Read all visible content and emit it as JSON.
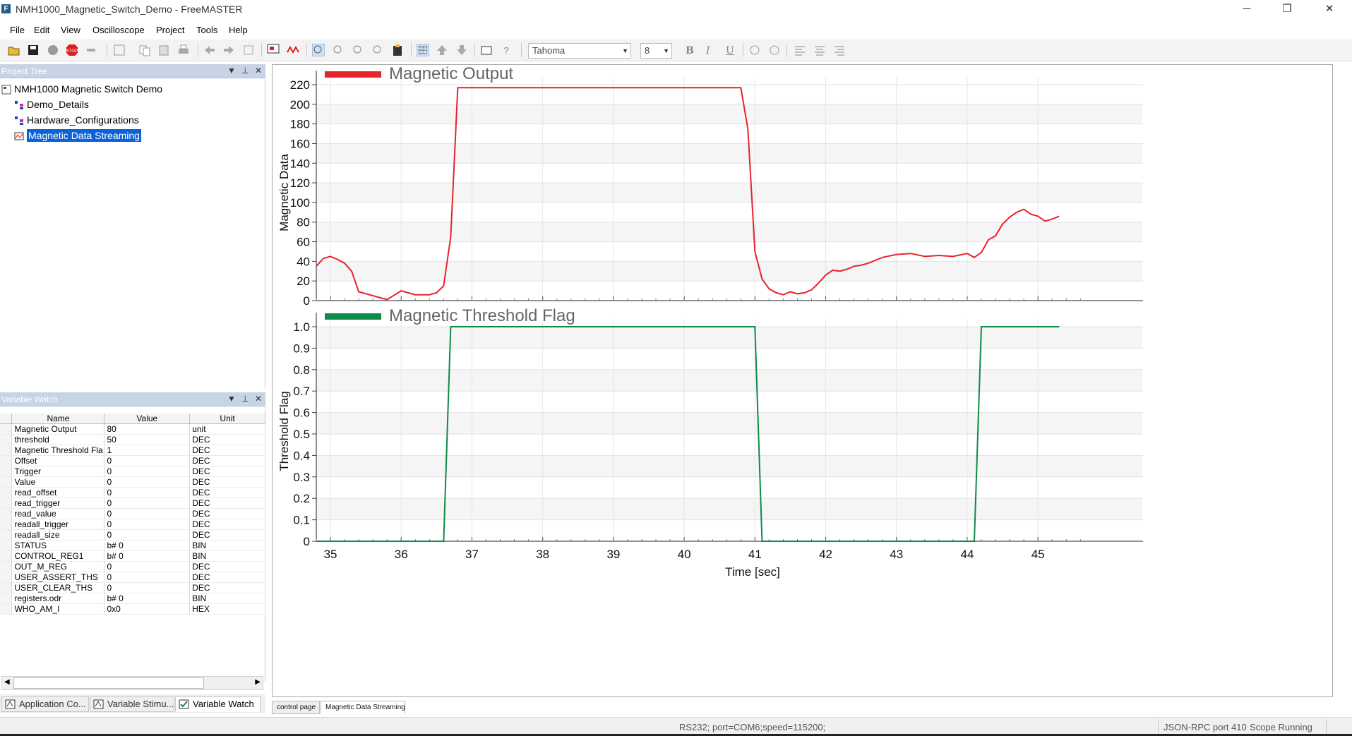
{
  "window": {
    "title": "NMH1000_Magnetic_Switch_Demo - FreeMASTER",
    "app_icon_letter": "F",
    "minimize": "─",
    "restore": "❐",
    "close": "✕"
  },
  "menu": [
    "File",
    "Edit",
    "View",
    "Oscilloscope",
    "Project",
    "Tools",
    "Help"
  ],
  "toolbar": {
    "font_name": "Tahoma",
    "font_size": "8",
    "bold": "B",
    "italic": "I",
    "underline": "U"
  },
  "project_tree": {
    "title": "Project Tree",
    "root": "NMH1000 Magnetic Switch Demo",
    "items": [
      "Demo_Details",
      "Hardware_Configurations",
      "Magnetic Data Streaming"
    ],
    "selected_index": 2
  },
  "variable_watch": {
    "title": "Variable Watch",
    "columns": [
      "Name",
      "Value",
      "Unit"
    ],
    "rows": [
      [
        "Magnetic Output",
        "80",
        "unit"
      ],
      [
        "threshold",
        "50",
        "DEC"
      ],
      [
        "Magnetic Threshold Fla",
        "1",
        "DEC"
      ],
      [
        "Offset",
        "0",
        "DEC"
      ],
      [
        "Trigger",
        "0",
        "DEC"
      ],
      [
        "Value",
        "0",
        "DEC"
      ],
      [
        "read_offset",
        "0",
        "DEC"
      ],
      [
        "read_trigger",
        "0",
        "DEC"
      ],
      [
        "read_value",
        "0",
        "DEC"
      ],
      [
        "readall_trigger",
        "0",
        "DEC"
      ],
      [
        "readall_size",
        "0",
        "DEC"
      ],
      [
        "STATUS",
        "b# 0",
        "BIN"
      ],
      [
        "CONTROL_REG1",
        "b# 0",
        "BIN"
      ],
      [
        "OUT_M_REG",
        "0",
        "DEC"
      ],
      [
        "USER_ASSERT_THS",
        "0",
        "DEC"
      ],
      [
        "USER_CLEAR_THS",
        "0",
        "DEC"
      ],
      [
        "registers.odr",
        "b# 0",
        "BIN"
      ],
      [
        "WHO_AM_I",
        "0x0",
        "HEX"
      ]
    ]
  },
  "bottom_tabs": [
    "Application Co...",
    "Variable Stimu...",
    "Variable Watch"
  ],
  "page_tabs": [
    "control page",
    "Magnetic Data Streaming"
  ],
  "status": {
    "connection": "RS232; port=COM6;speed=115200;",
    "rpc": "JSON-RPC port 410",
    "state": "Scope Running"
  },
  "chart_data": [
    {
      "type": "line",
      "series": [
        {
          "name": "Magnetic Output",
          "color": "#e8232a",
          "x": [
            34.8,
            34.9,
            35.0,
            35.1,
            35.2,
            35.3,
            35.4,
            35.6,
            35.8,
            36.0,
            36.2,
            36.4,
            36.5,
            36.6,
            36.7,
            36.8,
            40.8,
            40.9,
            41.0,
            41.1,
            41.2,
            41.3,
            41.4,
            41.5,
            41.6,
            41.7,
            41.8,
            41.9,
            42.0,
            42.1,
            42.2,
            42.3,
            42.4,
            42.5,
            42.6,
            42.8,
            43.0,
            43.2,
            43.4,
            43.6,
            43.8,
            44.0,
            44.1,
            44.2,
            44.3,
            44.4,
            44.5,
            44.6,
            44.7,
            44.8,
            44.9,
            45.0,
            45.1,
            45.2,
            45.3
          ],
          "y": [
            35,
            43,
            45,
            42,
            38,
            30,
            9,
            5,
            1,
            10,
            6,
            6,
            8,
            15,
            65,
            217,
            217,
            175,
            50,
            22,
            12,
            8,
            6,
            9,
            7,
            8,
            11,
            18,
            26,
            31,
            30,
            32,
            35,
            36,
            38,
            44,
            47,
            48,
            45,
            46,
            45,
            48,
            44,
            49,
            62,
            66,
            78,
            85,
            90,
            93,
            88,
            86,
            81,
            83,
            86
          ]
        }
      ],
      "ylabel": "Magnetic Data",
      "xlim": [
        34.8,
        45.8
      ],
      "ylim": [
        0,
        220
      ],
      "yticks": [
        0,
        20,
        40,
        60,
        80,
        100,
        120,
        140,
        160,
        180,
        200,
        220
      ],
      "grid": true,
      "legend": "top-left"
    },
    {
      "type": "line",
      "series": [
        {
          "name": "Magnetic Threshold Flag",
          "color": "#0e8a4a",
          "x": [
            34.8,
            36.6,
            36.7,
            41.0,
            41.1,
            44.1,
            44.2,
            45.3
          ],
          "y": [
            0,
            0,
            1,
            1,
            0,
            0,
            1,
            1
          ]
        }
      ],
      "xlabel": "Time [sec]",
      "ylabel": "Threshold Flag",
      "xlim": [
        34.8,
        45.8
      ],
      "ylim": [
        0,
        1.0
      ],
      "xticks": [
        35,
        36,
        37,
        38,
        39,
        40,
        41,
        42,
        43,
        44,
        45
      ],
      "yticks": [
        0,
        0.1,
        0.2,
        0.3,
        0.4,
        0.5,
        0.6,
        0.7,
        0.8,
        0.9,
        1.0
      ],
      "ytick_labels": [
        "0",
        "0.1",
        "0.2",
        "0.3",
        "0.4",
        "0.5",
        "0.6",
        "0.7",
        "0.8",
        "0.9",
        "1.0"
      ],
      "grid": true,
      "legend": "top-left"
    }
  ]
}
